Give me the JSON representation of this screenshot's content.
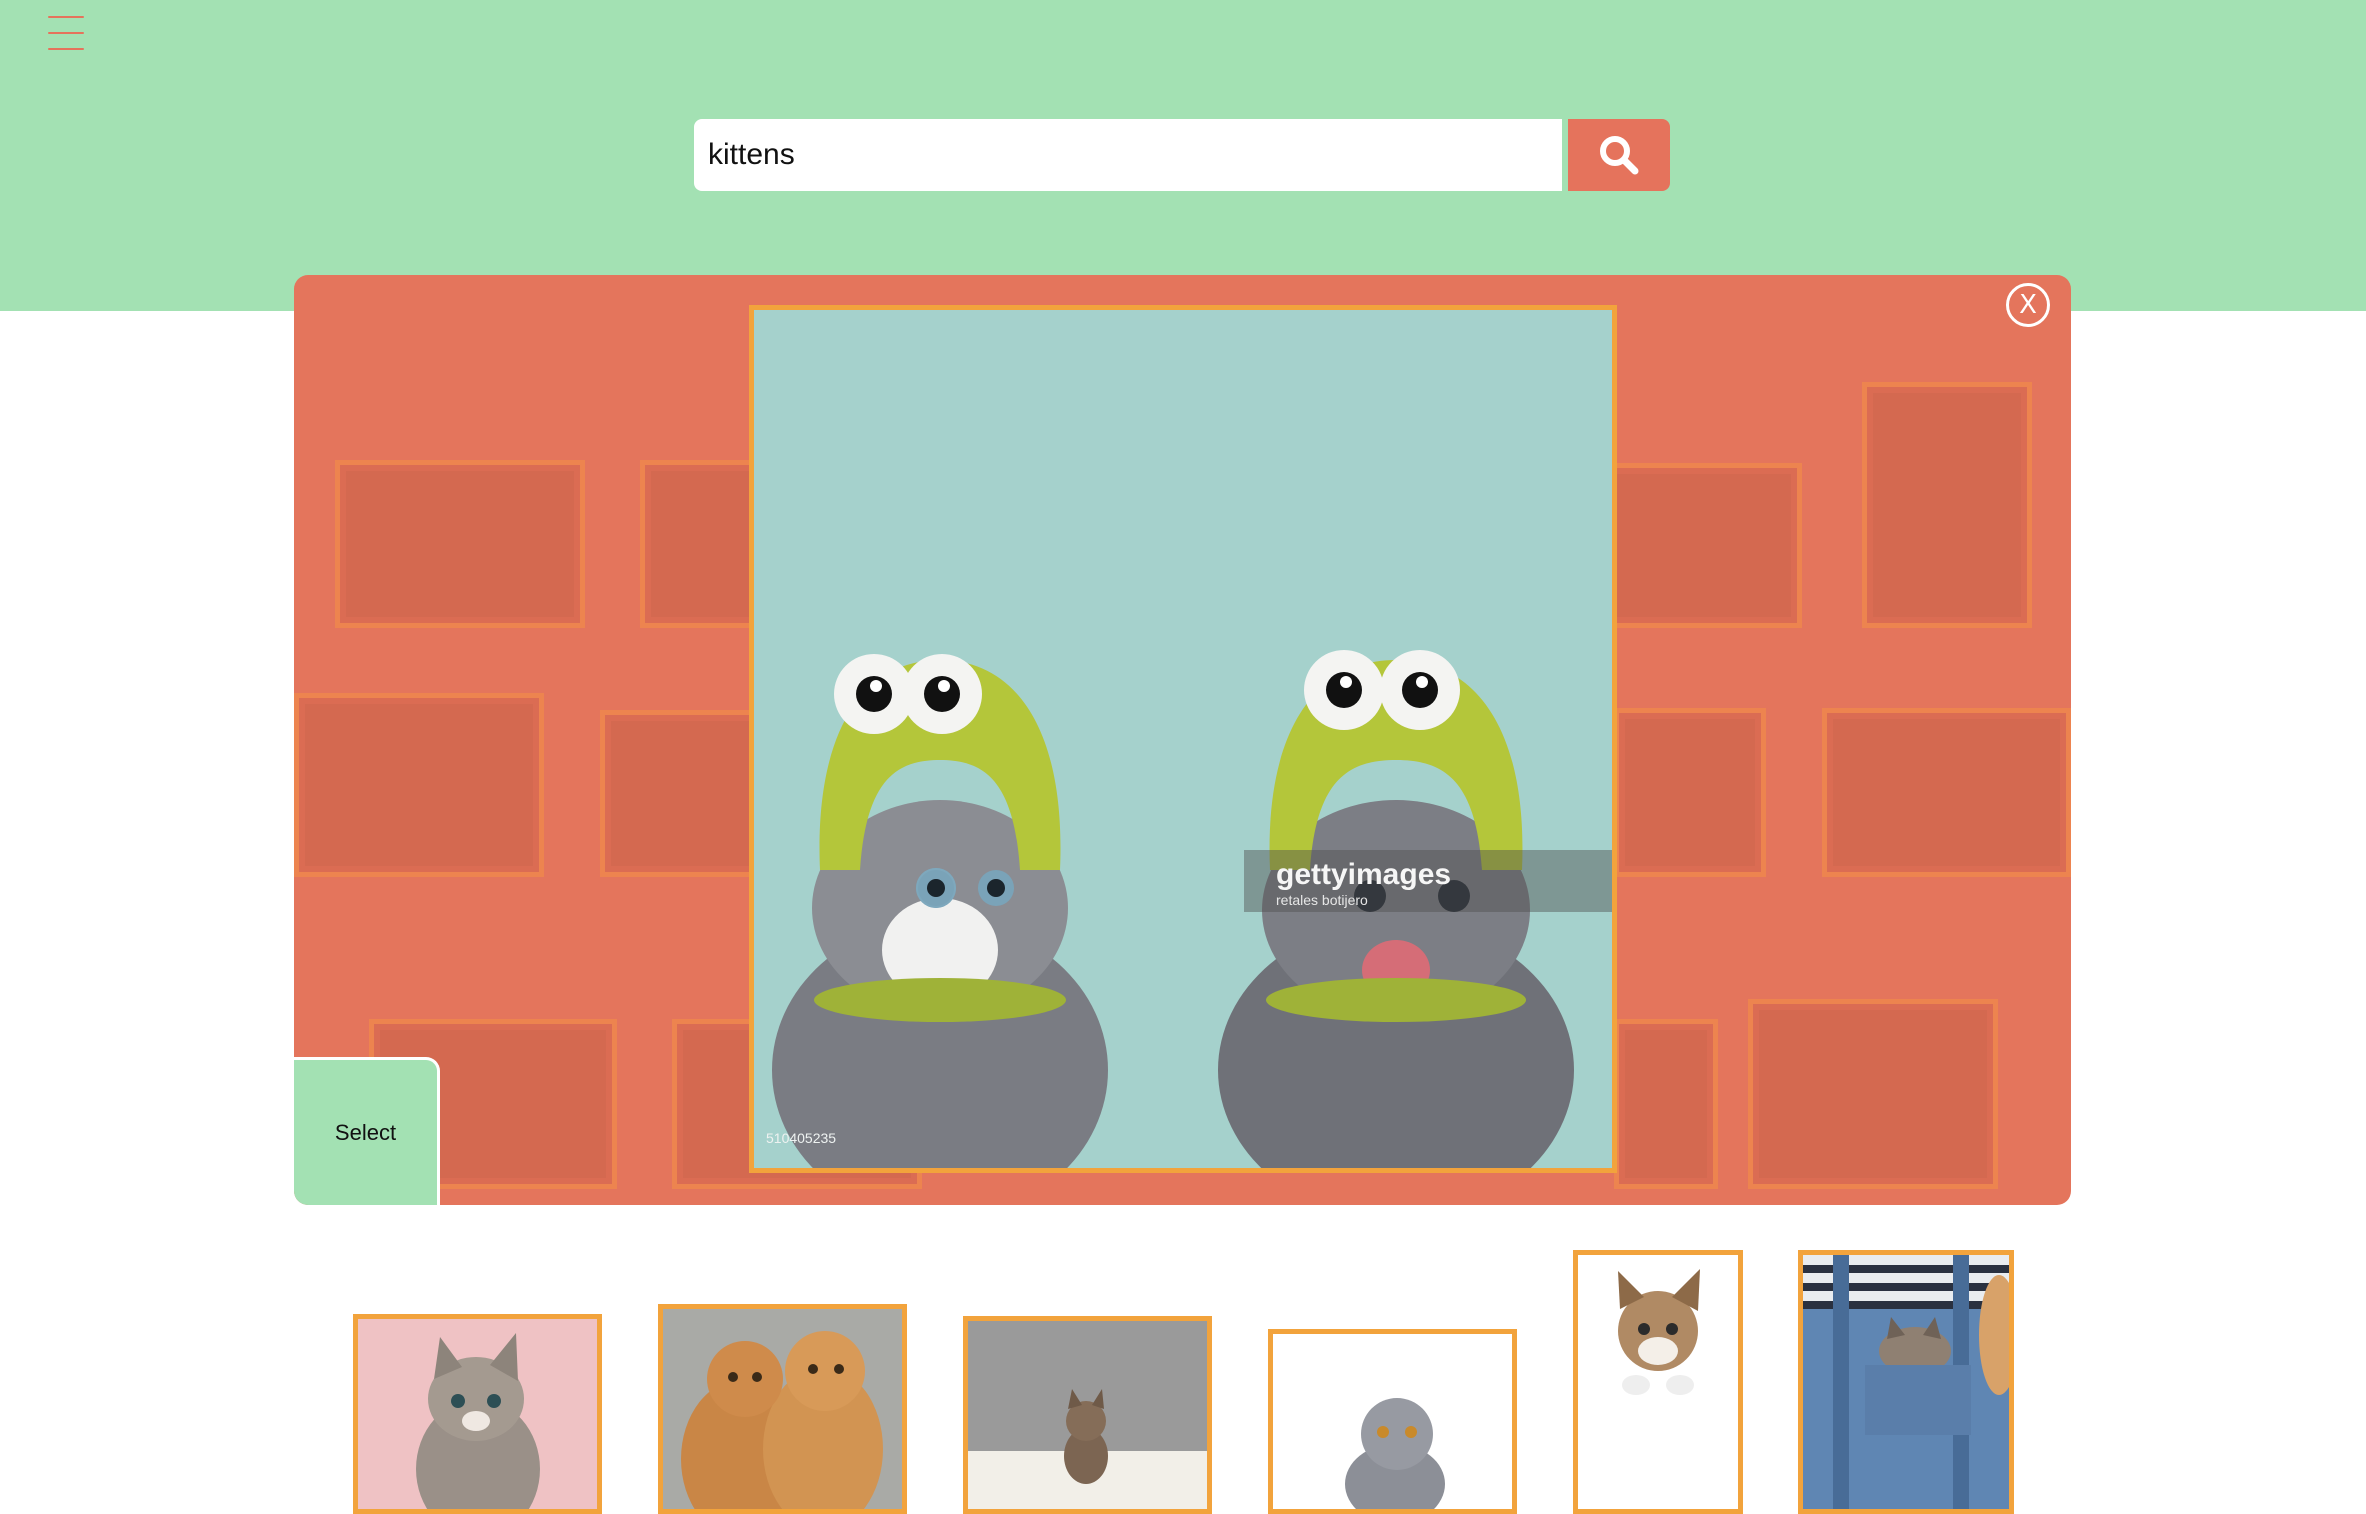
{
  "header": {
    "menu_icon": "hamburger-menu-icon",
    "search": {
      "value": "kittens",
      "button_icon": "search-icon"
    }
  },
  "modal": {
    "close_label": "X",
    "select_label": "Select",
    "featured_image": {
      "description": "two gray kittens wearing green knitted frog hats",
      "watermark_brand": "gettyimages",
      "watermark_credit": "retales botijero",
      "image_id": "510405235"
    }
  },
  "thumbnails": [
    {
      "alt": "tabby kitten on pink background"
    },
    {
      "alt": "two orange kittens"
    },
    {
      "alt": "tabby kitten on white fluff"
    },
    {
      "alt": "gray scottish fold kitten"
    },
    {
      "alt": "kitten peeking over edge"
    },
    {
      "alt": "kitten in denim overalls pocket"
    }
  ],
  "colors": {
    "header_bg": "#a3e1b3",
    "accent": "#e5735c",
    "modal_bg": "#e4755c",
    "frame": "#f2a33c"
  }
}
